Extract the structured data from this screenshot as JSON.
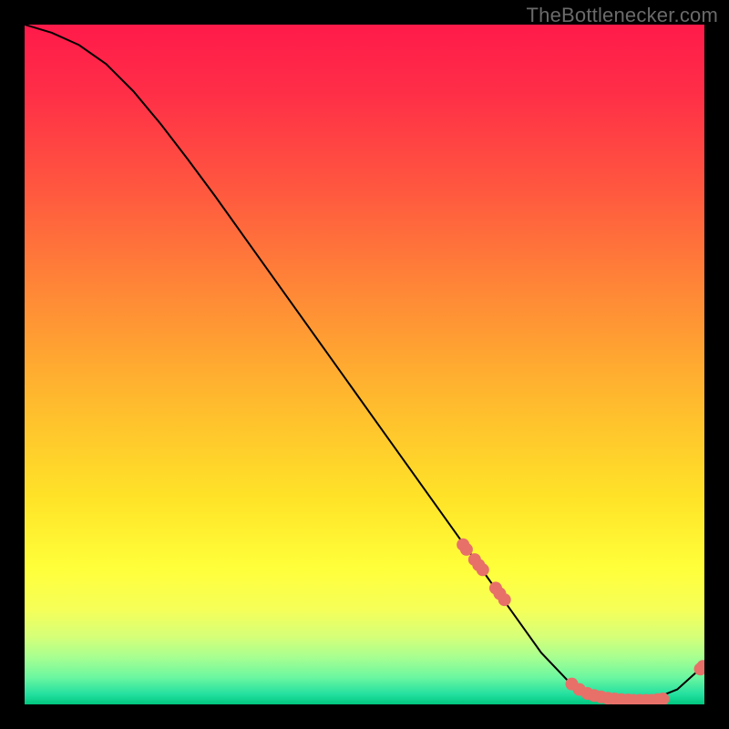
{
  "watermark": "TheBottlenecker.com",
  "chart_data": {
    "type": "line",
    "title": "",
    "xlabel": "",
    "ylabel": "",
    "xlim": [
      0,
      100
    ],
    "ylim": [
      0,
      100
    ],
    "grid": false,
    "curve": {
      "x": [
        0,
        4,
        8,
        12,
        16,
        20,
        24,
        28,
        32,
        36,
        40,
        44,
        48,
        52,
        56,
        60,
        64,
        68,
        72,
        76,
        80,
        84,
        88,
        92,
        96,
        100
      ],
      "y": [
        100,
        98.8,
        97.0,
        94.2,
        90.2,
        85.4,
        80.2,
        74.8,
        69.2,
        63.6,
        58.0,
        52.4,
        46.8,
        41.2,
        35.6,
        30.0,
        24.4,
        18.8,
        13.2,
        7.6,
        3.4,
        1.4,
        0.6,
        0.6,
        2.2,
        5.8
      ]
    },
    "dot_clusters": [
      {
        "x": [
          64.5,
          65.0,
          66.2,
          66.8,
          67.4,
          69.3,
          69.9,
          70.6
        ],
        "y": [
          23.5,
          22.8,
          21.3,
          20.5,
          19.8,
          17.1,
          16.3,
          15.4
        ]
      },
      {
        "x": [
          80.5,
          81.6,
          82.8,
          83.8,
          84.8,
          85.8,
          86.8,
          87.8,
          88.8,
          89.6,
          90.5,
          91.4,
          92.2,
          93.1,
          93.9
        ],
        "y": [
          3.0,
          2.2,
          1.6,
          1.3,
          1.1,
          0.9,
          0.8,
          0.7,
          0.65,
          0.6,
          0.6,
          0.6,
          0.6,
          0.7,
          0.8
        ]
      },
      {
        "x": [
          99.4,
          99.8
        ],
        "y": [
          5.2,
          5.6
        ]
      }
    ],
    "gradient_stops": [
      {
        "offset": 0.0,
        "color": "#ff1a4a"
      },
      {
        "offset": 0.1,
        "color": "#ff2e47"
      },
      {
        "offset": 0.25,
        "color": "#ff5a3f"
      },
      {
        "offset": 0.4,
        "color": "#ff8a36"
      },
      {
        "offset": 0.55,
        "color": "#ffb92e"
      },
      {
        "offset": 0.7,
        "color": "#ffe428"
      },
      {
        "offset": 0.8,
        "color": "#ffff3a"
      },
      {
        "offset": 0.86,
        "color": "#f6ff58"
      },
      {
        "offset": 0.9,
        "color": "#d6ff78"
      },
      {
        "offset": 0.93,
        "color": "#a8ff90"
      },
      {
        "offset": 0.96,
        "color": "#6cf7a0"
      },
      {
        "offset": 0.985,
        "color": "#24e0a0"
      },
      {
        "offset": 1.0,
        "color": "#00c77f"
      }
    ],
    "dot_color": "#e77069",
    "line_color": "#000000"
  }
}
